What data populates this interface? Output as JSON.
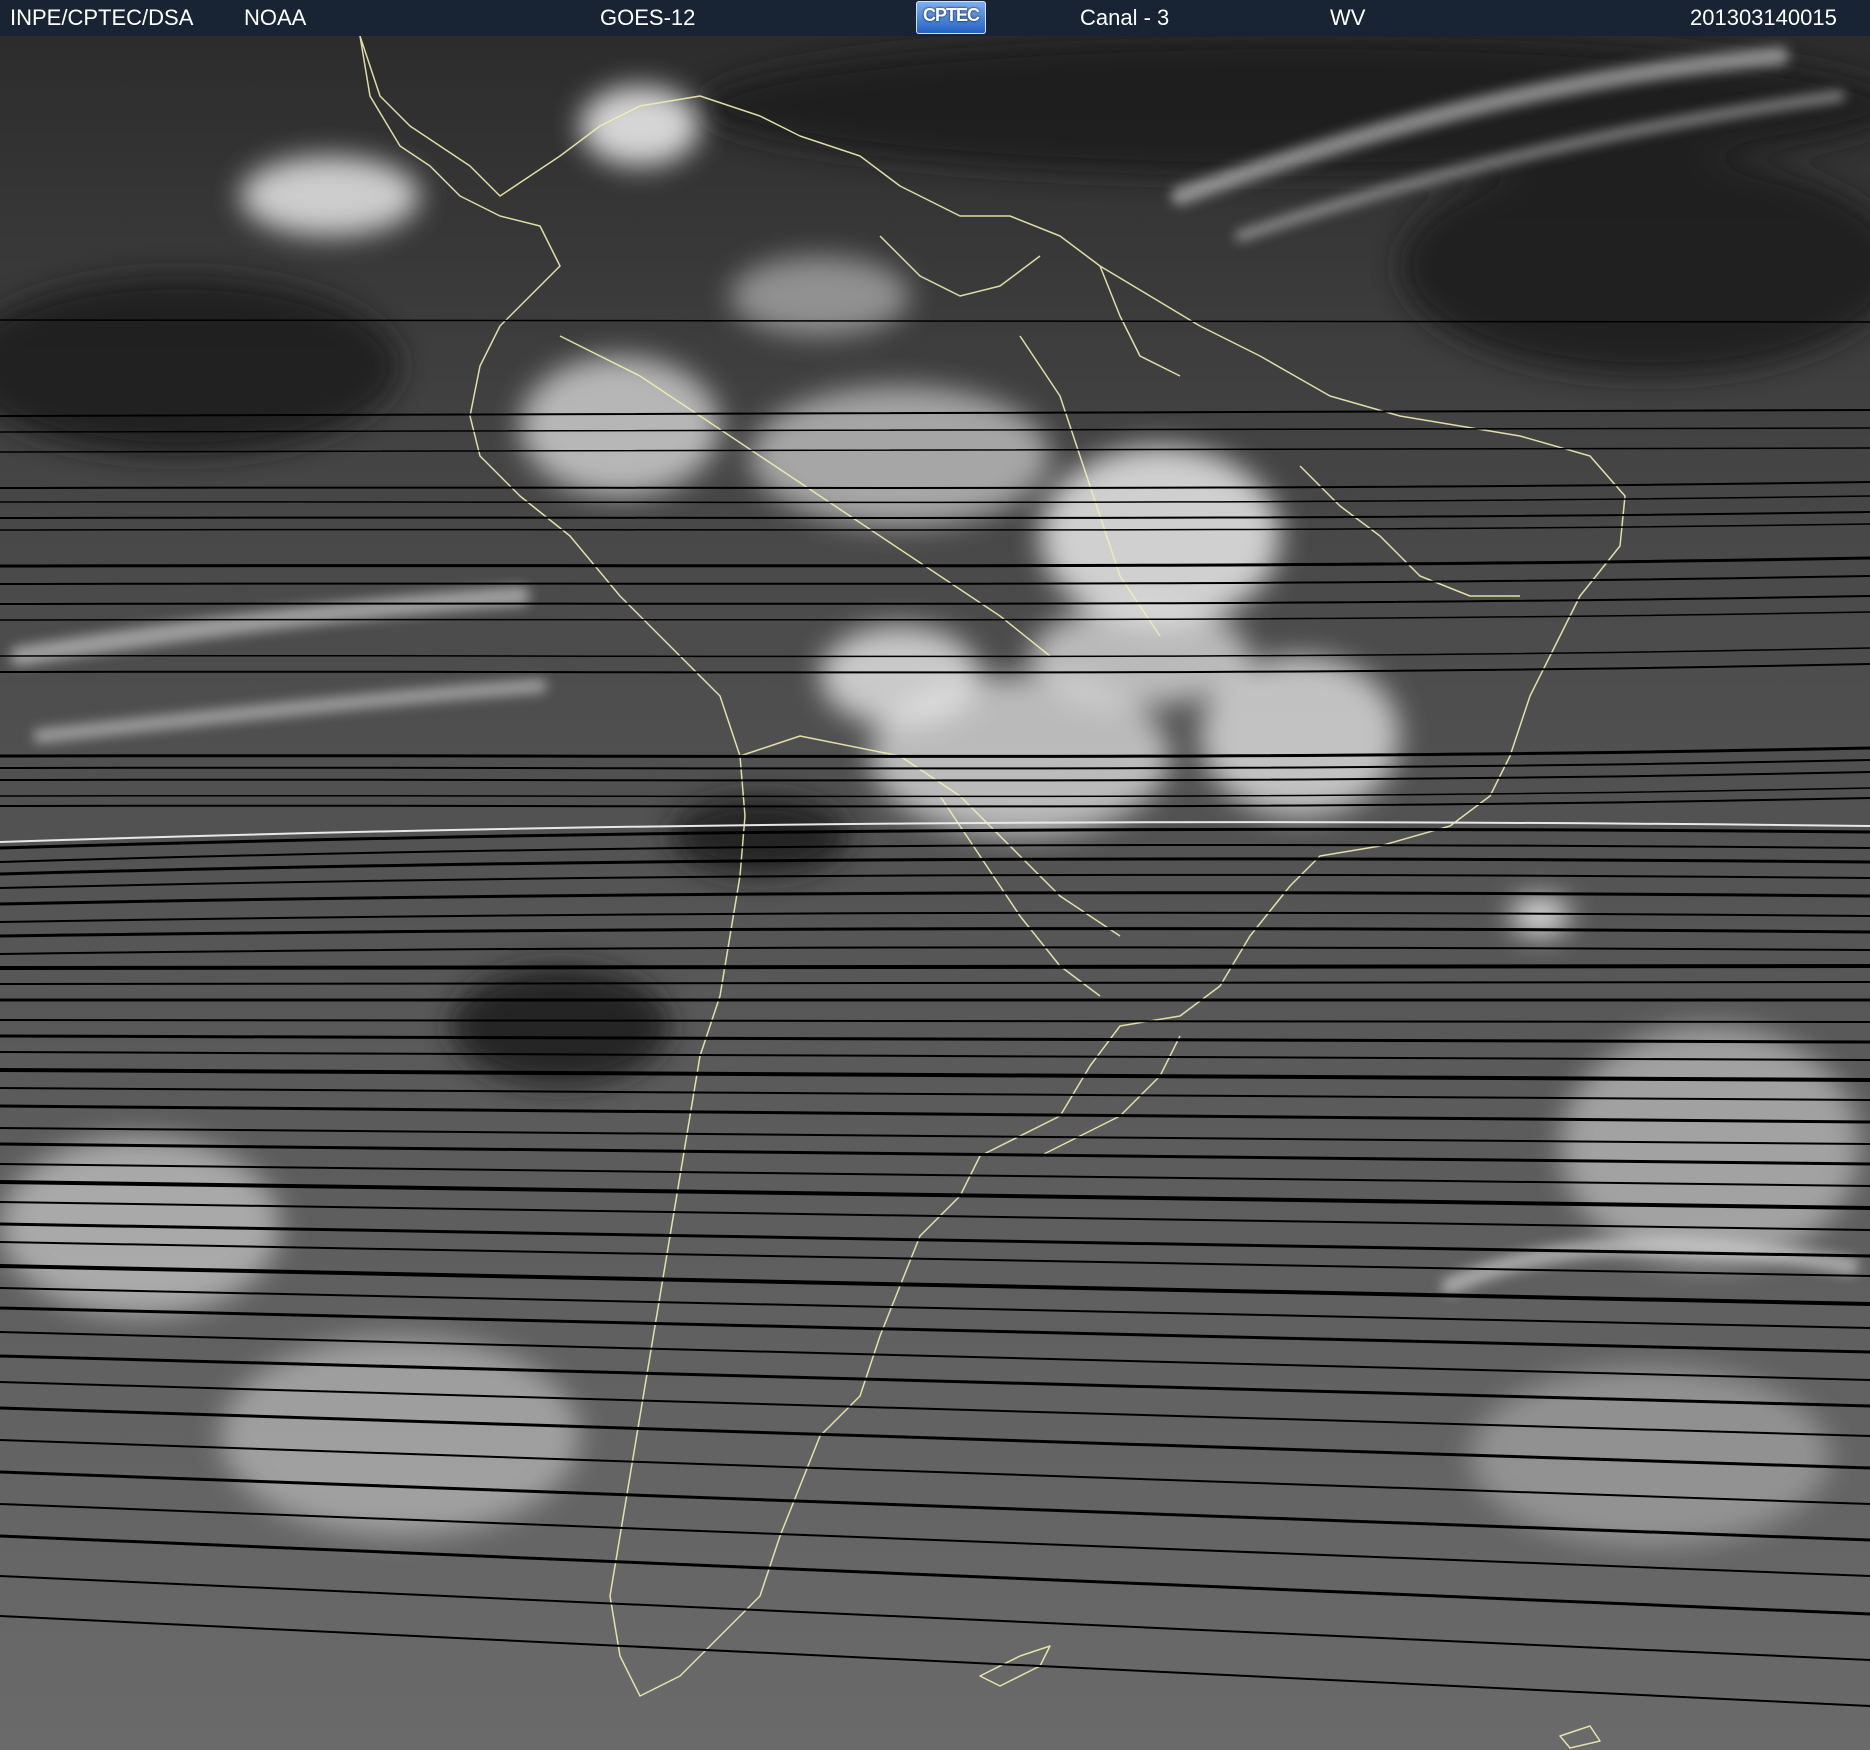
{
  "header": {
    "org": "INPE/CPTEC/DSA",
    "agency": "NOAA",
    "satellite": "GOES-12",
    "logo_text": "CPTEC",
    "channel": "Canal - 3",
    "band": "WV",
    "timestamp": "201303140015"
  },
  "colors": {
    "header_bg": "#182433",
    "coastline": "#f0f0b0",
    "scan_lines": "#000000"
  },
  "map": {
    "imagery": "water-vapour satellite image, grayscale",
    "region": "South America",
    "icons": [
      "cptec-logo-icon"
    ]
  }
}
